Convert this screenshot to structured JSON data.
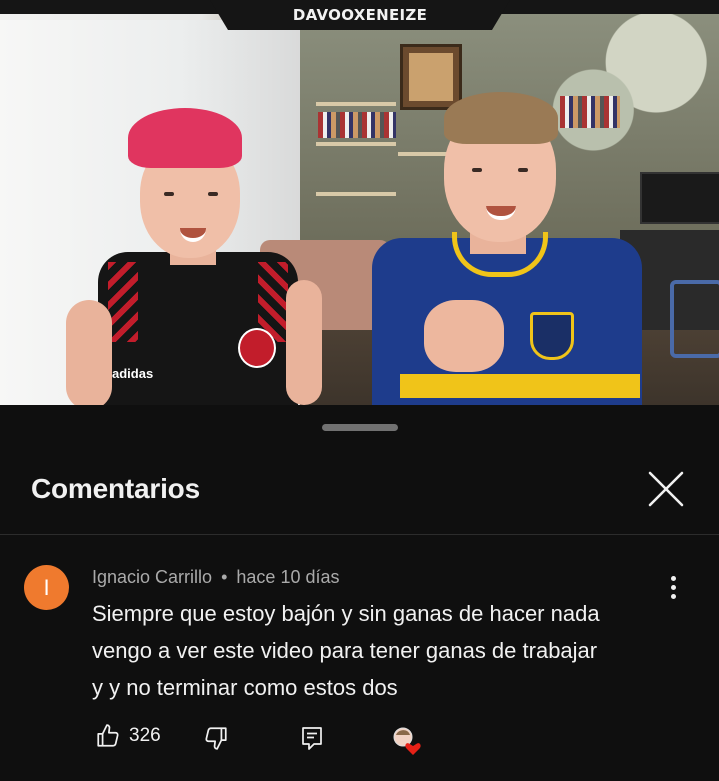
{
  "video": {
    "channel_banner": "DAVOOXENEIZE",
    "jersey_sponsor_text": "adidas"
  },
  "comments_panel": {
    "title": "Comentarios",
    "close_icon": "close-x-icon"
  },
  "comment": {
    "avatar_initial": "I",
    "avatar_color": "#ef7a2e",
    "author": "Ignacio Carrillo",
    "separator": "•",
    "time": "hace 10 días",
    "text_lines": [
      "Siempre que estoy bajón  y sin ganas de hacer nada",
      "vengo a ver este video para tener ganas de trabajar",
      "y y no terminar como estos dos"
    ],
    "like_count": "326",
    "icons": {
      "like": "thumbs-up-icon",
      "dislike": "thumbs-down-icon",
      "reply": "reply-comment-icon",
      "creator_heart": "creator-heart-icon",
      "more": "more-vertical-icon"
    }
  },
  "colors": {
    "background": "#0f0f0f",
    "text_primary": "#f1f1f1",
    "text_secondary": "#aaaaaa",
    "heart": "#e62117"
  }
}
